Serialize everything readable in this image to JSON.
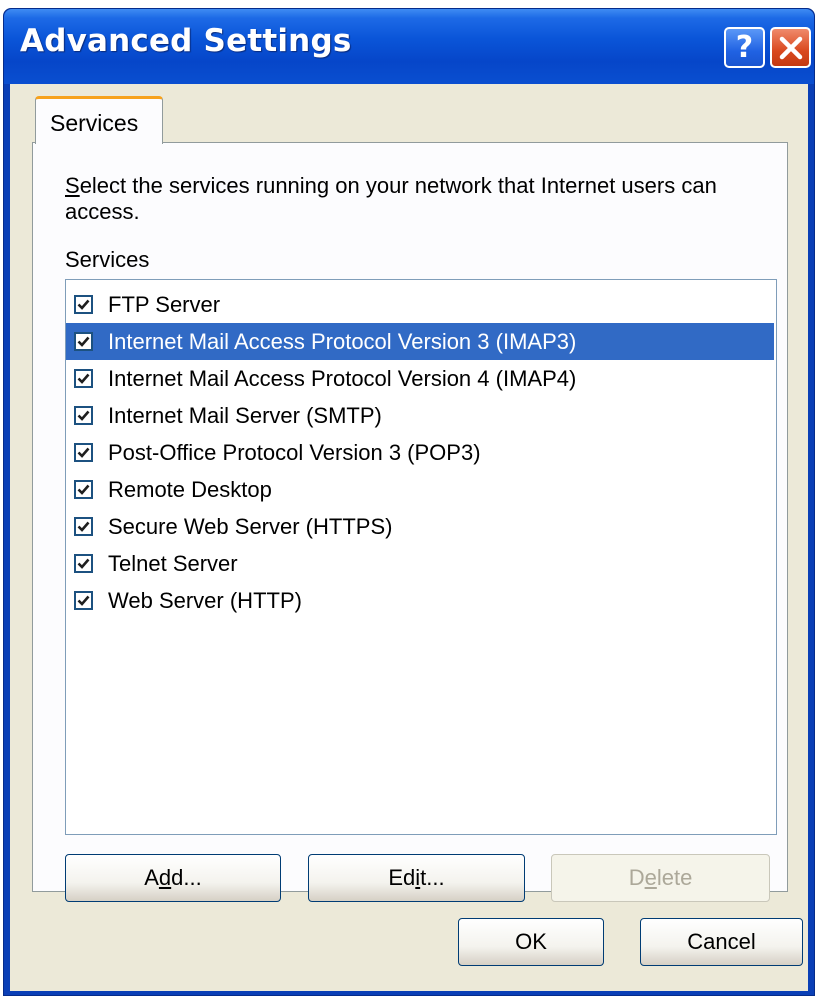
{
  "window": {
    "title": "Advanced Settings",
    "help_glyph": "?"
  },
  "tab": {
    "label": "Services"
  },
  "description": {
    "accel": "S",
    "rest": "elect the services running on your network that Internet users can access."
  },
  "services_label": "Services",
  "services": [
    {
      "label": "FTP Server",
      "checked": true,
      "selected": false
    },
    {
      "label": "Internet Mail Access Protocol Version 3 (IMAP3)",
      "checked": true,
      "selected": true
    },
    {
      "label": "Internet Mail Access Protocol Version 4 (IMAP4)",
      "checked": true,
      "selected": false
    },
    {
      "label": "Internet Mail Server (SMTP)",
      "checked": true,
      "selected": false
    },
    {
      "label": "Post-Office Protocol Version 3 (POP3)",
      "checked": true,
      "selected": false
    },
    {
      "label": "Remote Desktop",
      "checked": true,
      "selected": false
    },
    {
      "label": "Secure Web Server (HTTPS)",
      "checked": true,
      "selected": false
    },
    {
      "label": "Telnet Server",
      "checked": true,
      "selected": false
    },
    {
      "label": "Web Server (HTTP)",
      "checked": true,
      "selected": false
    }
  ],
  "buttons": {
    "add": {
      "pre": "A",
      "accel": "d",
      "post": "d..."
    },
    "edit": {
      "pre": "Ed",
      "accel": "i",
      "post": "t..."
    },
    "delete": {
      "pre": "D",
      "accel": "e",
      "post": "lete",
      "disabled": true
    },
    "ok": "OK",
    "cancel": "Cancel"
  },
  "colors": {
    "titlebar": "#0a55d8",
    "selection": "#316ac5",
    "dialog_bg": "#ece9d8",
    "tab_accent": "#f7a21c"
  }
}
